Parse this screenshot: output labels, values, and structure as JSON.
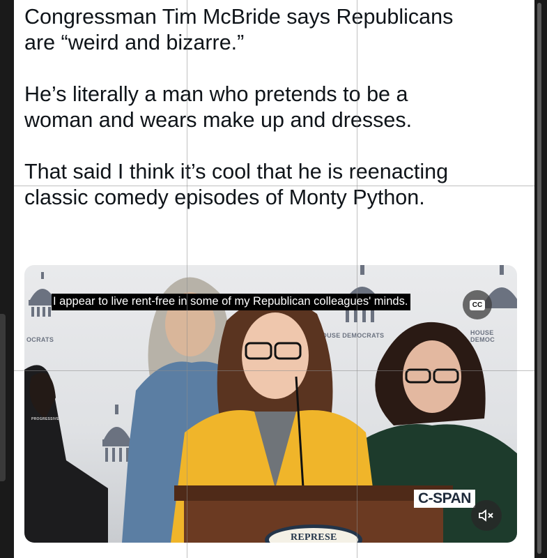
{
  "post": {
    "lines": [
      "Congressman Tim McBride says Republicans\nare “weird and bizarre.”",
      "He’s literally a man who pretends to be a\nwoman and wears make up and dresses.",
      "That said I think it’s cool that he is reenacting\nclassic comedy episodes of Monty Python."
    ]
  },
  "video": {
    "caption": "I appear to live rent-free in some of my Republican colleagues' minds.",
    "cc_label": "CC",
    "watermark": "C-SPAN",
    "backdrop_text_1": "OCRATS",
    "backdrop_text_2": "HOUSE DEMOCRATS",
    "backdrop_text_3": "HOUSE DEMOC",
    "podium_text": "REPRESE",
    "shirt_text": "PROGRESSIVE"
  },
  "icons": {
    "mute": "speaker-muted-icon",
    "cc": "closed-captions-icon"
  },
  "colors": {
    "text": "#0f1419",
    "jacket": "#f0b52a",
    "podium": "#6b3a22",
    "background": "#000000"
  }
}
